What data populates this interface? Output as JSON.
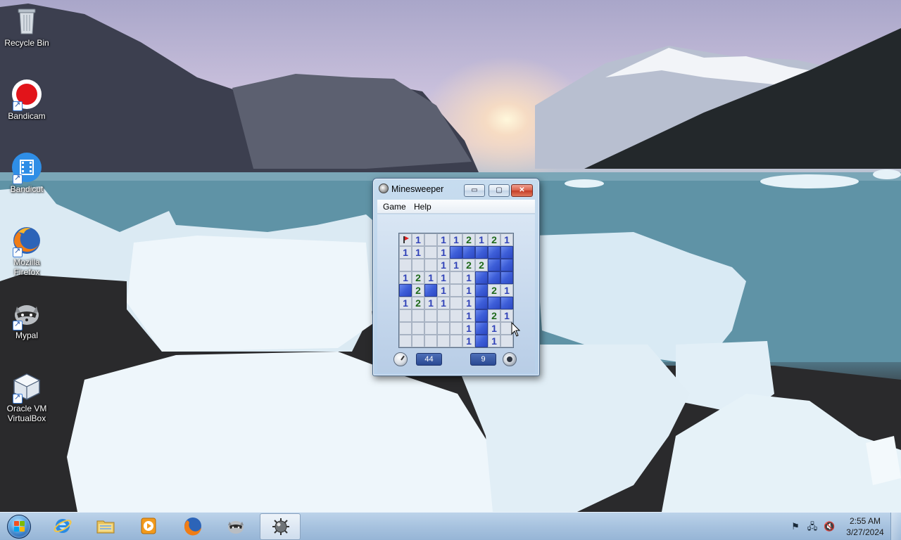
{
  "desktop": {
    "icons": [
      {
        "label": "Recycle Bin",
        "icon": "recycle-bin-icon"
      },
      {
        "label": "Bandicam",
        "icon": "bandicam-icon"
      },
      {
        "label": "Bandicut",
        "icon": "bandicut-icon"
      },
      {
        "label": "Mozilla Firefox",
        "icon": "firefox-icon"
      },
      {
        "label": "Mypal",
        "icon": "mypal-icon"
      },
      {
        "label": "Oracle VM VirtualBox",
        "icon": "virtualbox-icon"
      }
    ]
  },
  "window": {
    "title": "Minesweeper",
    "menu": {
      "game": "Game",
      "help": "Help"
    },
    "captions": {
      "minimize": "▭",
      "maximize": "▢",
      "close": "✕"
    }
  },
  "game": {
    "board": [
      [
        "F",
        "1",
        "0",
        "1",
        "1",
        "2",
        "1",
        "2",
        "1"
      ],
      [
        "1",
        "1",
        "0",
        "1",
        "H",
        "H",
        "H",
        "H",
        "H"
      ],
      [
        "0",
        "0",
        "0",
        "1",
        "1",
        "2",
        "2",
        "H",
        "H"
      ],
      [
        "1",
        "2",
        "1",
        "1",
        "0",
        "1",
        "H",
        "H",
        "H"
      ],
      [
        "H",
        "2",
        "H",
        "1",
        "0",
        "1",
        "H",
        "2",
        "1"
      ],
      [
        "1",
        "2",
        "1",
        "1",
        "0",
        "1",
        "H",
        "H",
        "H"
      ],
      [
        "0",
        "0",
        "0",
        "0",
        "0",
        "1",
        "H",
        "2",
        "1"
      ],
      [
        "0",
        "0",
        "0",
        "0",
        "0",
        "1",
        "H",
        "1",
        "0"
      ],
      [
        "0",
        "0",
        "0",
        "0",
        "0",
        "1",
        "H",
        "1",
        "0"
      ]
    ],
    "timer": "44",
    "mines_left": "9"
  },
  "taskbar": {
    "pinned": [
      {
        "name": "internet-explorer",
        "icon": "ie-icon"
      },
      {
        "name": "file-explorer",
        "icon": "folder-icon"
      },
      {
        "name": "media-player",
        "icon": "media-player-icon"
      },
      {
        "name": "firefox",
        "icon": "firefox-icon"
      },
      {
        "name": "mypal",
        "icon": "mypal-icon"
      },
      {
        "name": "minesweeper",
        "icon": "minesweeper-icon",
        "active": true
      }
    ],
    "clock": {
      "time": "2:55 AM",
      "date": "3/27/2024"
    }
  },
  "colors": {
    "hidden_tile": "#3d5ed8",
    "number_1": "#3042b8",
    "number_2": "#1f6a1b",
    "taskbar": "#a9c4e0",
    "close_button": "#c43c26"
  }
}
